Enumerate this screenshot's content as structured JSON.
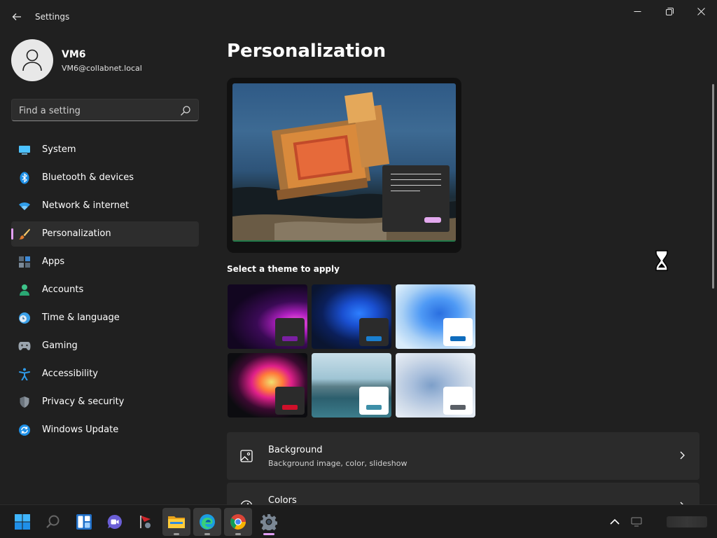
{
  "app": {
    "title": "Settings"
  },
  "window_controls": {
    "minimize": "minimize-icon",
    "maximize": "maximize-icon",
    "close": "close-icon"
  },
  "user": {
    "name": "VM6",
    "email": "VM6@collabnet.local"
  },
  "search": {
    "placeholder": "Find a setting"
  },
  "nav": {
    "items": [
      {
        "label": "System",
        "icon": "monitor-icon",
        "active": false
      },
      {
        "label": "Bluetooth & devices",
        "icon": "bluetooth-icon",
        "active": false
      },
      {
        "label": "Network & internet",
        "icon": "wifi-icon",
        "active": false
      },
      {
        "label": "Personalization",
        "icon": "paintbrush-icon",
        "active": true
      },
      {
        "label": "Apps",
        "icon": "apps-icon",
        "active": false
      },
      {
        "label": "Accounts",
        "icon": "person-icon",
        "active": false
      },
      {
        "label": "Time & language",
        "icon": "clock-globe-icon",
        "active": false
      },
      {
        "label": "Gaming",
        "icon": "gamepad-icon",
        "active": false
      },
      {
        "label": "Accessibility",
        "icon": "accessibility-icon",
        "active": false
      },
      {
        "label": "Privacy & security",
        "icon": "shield-icon",
        "active": false
      },
      {
        "label": "Windows Update",
        "icon": "update-icon",
        "active": false
      }
    ]
  },
  "main": {
    "title": "Personalization",
    "theme_section_label": "Select a theme to apply",
    "themes": [
      {
        "name": "glow-dark",
        "accent": "#7a1fa2"
      },
      {
        "name": "bloom-dark",
        "accent": "#1a7fd0"
      },
      {
        "name": "bloom-light",
        "accent": "#0f6cbd"
      },
      {
        "name": "captured-motion",
        "accent": "#d0102a"
      },
      {
        "name": "sunrise-lake",
        "accent": "#3d8fa8"
      },
      {
        "name": "flow",
        "accent": "#5a5f66"
      }
    ],
    "cards": [
      {
        "title": "Background",
        "subtitle": "Background image, color, slideshow",
        "icon": "image-icon"
      },
      {
        "title": "Colors",
        "subtitle": "",
        "icon": "palette-icon"
      }
    ]
  },
  "taskbar": {
    "apps": [
      {
        "name": "start-icon",
        "running": false
      },
      {
        "name": "search-icon",
        "running": false
      },
      {
        "name": "widgets-icon",
        "running": false
      },
      {
        "name": "chat-icon",
        "running": false
      },
      {
        "name": "flag-app-icon",
        "running": false
      },
      {
        "name": "file-explorer-icon",
        "running": true
      },
      {
        "name": "edge-icon",
        "running": true
      },
      {
        "name": "chrome-icon",
        "running": true
      },
      {
        "name": "settings-gear-icon",
        "running": true,
        "active": true
      }
    ]
  },
  "colors": {
    "background": "#202020",
    "accent": "#e39ff6",
    "card": "#2b2b2b"
  }
}
